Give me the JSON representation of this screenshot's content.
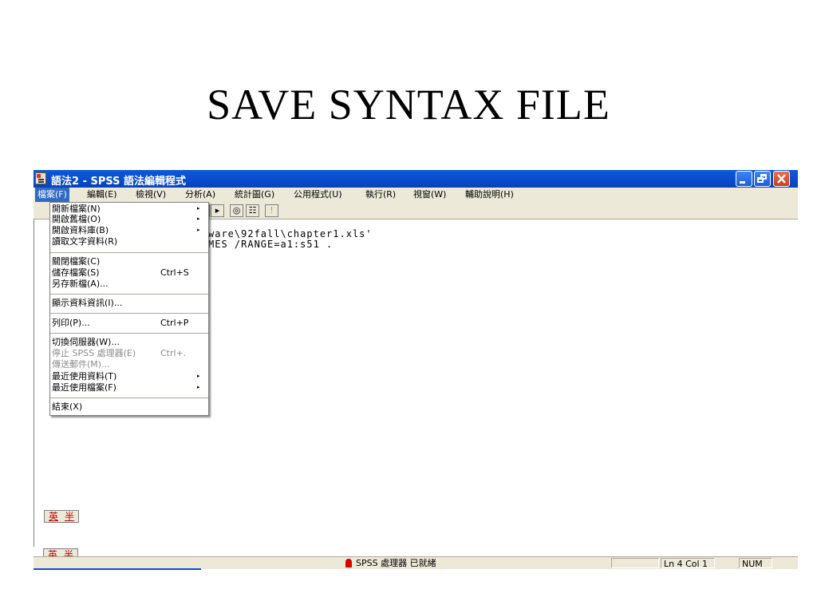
{
  "slide": {
    "title": "SAVE SYNTAX FILE"
  },
  "window": {
    "title": "語法2 - SPSS 語法編輯程式"
  },
  "menubar": {
    "items": [
      "檔案(F)",
      "編輯(E)",
      "檢視(V)",
      "分析(A)",
      "統計圖(G)",
      "公用程式(U)",
      "執行(R)",
      "視窗(W)",
      "輔助說明(H)"
    ]
  },
  "toolbar": {
    "run": "▸",
    "glasses": "◎",
    "syntax": "☷",
    "info": "!"
  },
  "editor": {
    "lines": [
      "ware\\92fall\\chapter1.xls'",
      "MES /RANGE=a1:s51 ."
    ]
  },
  "file_menu": {
    "items": [
      {
        "label": "開新檔案(N)",
        "shortcut": "",
        "submenu": true,
        "disabled": false
      },
      {
        "label": "開啟舊檔(O)",
        "shortcut": "",
        "submenu": true,
        "disabled": false
      },
      {
        "label": "開啟資料庫(B)",
        "shortcut": "",
        "submenu": true,
        "disabled": false
      },
      {
        "label": "讀取文字資料(R)",
        "shortcut": "",
        "submenu": false,
        "disabled": false
      },
      {
        "label": "關閉檔案(C)",
        "shortcut": "",
        "submenu": false,
        "disabled": false
      },
      {
        "label": "儲存檔案(S)",
        "shortcut": "Ctrl+S",
        "submenu": false,
        "disabled": false
      },
      {
        "label": "另存新檔(A)...",
        "shortcut": "",
        "submenu": false,
        "disabled": false
      },
      {
        "label": "顯示資料資訊(I)...",
        "shortcut": "",
        "submenu": false,
        "disabled": false
      },
      {
        "label": "列印(P)...",
        "shortcut": "Ctrl+P",
        "submenu": false,
        "disabled": false
      },
      {
        "label": "切換伺服器(W)...",
        "shortcut": "",
        "submenu": false,
        "disabled": false
      },
      {
        "label": "停止 SPSS 處理器(E)",
        "shortcut": "Ctrl+.",
        "submenu": false,
        "disabled": true
      },
      {
        "label": "傳送郵件(M)...",
        "shortcut": "",
        "submenu": false,
        "disabled": true
      },
      {
        "label": "最近使用資料(T)",
        "shortcut": "",
        "submenu": true,
        "disabled": false
      },
      {
        "label": "最近使用檔案(F)",
        "shortcut": "",
        "submenu": true,
        "disabled": false
      },
      {
        "label": "結束(X)",
        "shortcut": "",
        "submenu": false,
        "disabled": false
      }
    ]
  },
  "ime": {
    "char1": "英",
    "char2": "半"
  },
  "statusbar": {
    "processor": "SPSS 處理器  已就緒",
    "position": "Ln 4 Col 1",
    "num": "NUM"
  }
}
